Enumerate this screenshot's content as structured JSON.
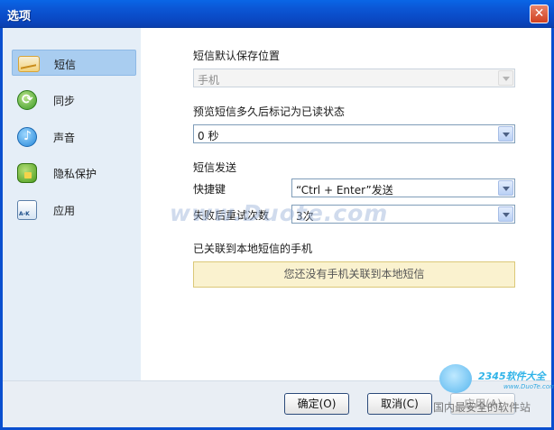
{
  "window": {
    "title": "选项",
    "close_symbol": "✕"
  },
  "sidebar": {
    "items": [
      {
        "label": "短信",
        "icon": "message-icon",
        "active": true
      },
      {
        "label": "同步",
        "icon": "sync-icon",
        "active": false
      },
      {
        "label": "声音",
        "icon": "sound-icon",
        "active": false
      },
      {
        "label": "隐私保护",
        "icon": "privacy-lock-icon",
        "active": false
      },
      {
        "label": "应用",
        "icon": "app-icon",
        "active": false
      }
    ]
  },
  "settings": {
    "save_location": {
      "label": "短信默认保存位置",
      "value": "手机"
    },
    "read_delay": {
      "label": "预览短信多久后标记为已读状态",
      "value": "0 秒"
    },
    "send_section_label": "短信发送",
    "shortcut": {
      "label": "快捷键",
      "value": "“Ctrl + Enter”发送"
    },
    "retry": {
      "label": "失败后重试次数",
      "value": "3次"
    },
    "linked_phones": {
      "label": "已关联到本地短信的手机",
      "notice": "您还没有手机关联到本地短信"
    }
  },
  "buttons": {
    "ok": "确定(O)",
    "cancel": "取消(C)",
    "apply": "应用(A)"
  },
  "watermark": {
    "big": "www.Duote.com",
    "brand": "2345软件大全",
    "url": "www.DuoTe.com",
    "text": "国内最安全的软件站"
  }
}
